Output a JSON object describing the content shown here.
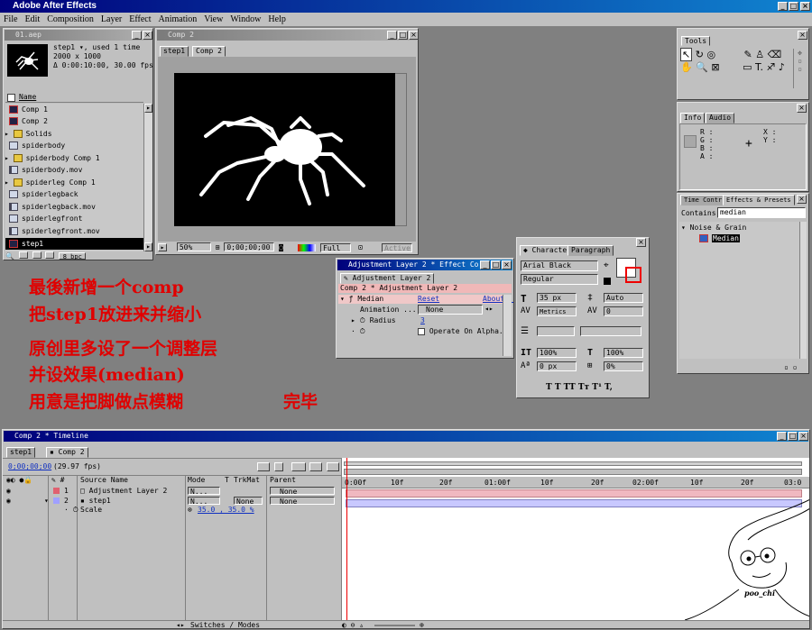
{
  "app": {
    "title": "Adobe After Effects"
  },
  "menu": [
    "File",
    "Edit",
    "Composition",
    "Layer",
    "Effect",
    "Animation",
    "View",
    "Window",
    "Help"
  ],
  "project": {
    "title": "01.aep",
    "info": [
      "step1 ▾, used 1 time",
      "2000 x 1000",
      "Δ 0:00:10:00, 30.00 fps"
    ],
    "header": "Name",
    "items": [
      {
        "name": "Comp 1",
        "type": "comp"
      },
      {
        "name": "Comp 2",
        "type": "comp"
      },
      {
        "name": "Solids",
        "type": "folder"
      },
      {
        "name": "spiderbody",
        "type": "still"
      },
      {
        "name": "spiderbody Comp 1",
        "type": "folder"
      },
      {
        "name": "spiderbody.mov",
        "type": "movie"
      },
      {
        "name": "spiderleg Comp 1",
        "type": "folder"
      },
      {
        "name": "spiderlegback",
        "type": "still"
      },
      {
        "name": "spiderlegback.mov",
        "type": "movie"
      },
      {
        "name": "spiderlegfront",
        "type": "still"
      },
      {
        "name": "spiderlegfront.mov",
        "type": "movie"
      },
      {
        "name": "step1",
        "type": "comp",
        "selected": true
      }
    ],
    "bpc": "8 bpc"
  },
  "comp": {
    "title": "Comp 2",
    "tabs": [
      "step1",
      "Comp 2"
    ],
    "zoom": "50%",
    "time": "0;00;00;00",
    "resolution": "Full",
    "view": "Active"
  },
  "tools": {
    "title": "Tools"
  },
  "info": {
    "tabs": [
      "Info",
      "Audio"
    ],
    "r": "R :",
    "g": "G :",
    "b": "B :",
    "a": "A :",
    "x": "X :",
    "y": "Y :"
  },
  "effects_presets": {
    "tabs": [
      "Time Contr",
      "Effects & Presets"
    ],
    "contains_label": "Contains:",
    "search": "median",
    "category": "Noise & Grain",
    "effect": "Median"
  },
  "effect_controls": {
    "title": "Adjustment Layer 2 * Effect Co",
    "tab": "Adjustment Layer 2",
    "breadcrumb": "Comp 2 * Adjustment Layer 2",
    "effect": "Median",
    "reset": "Reset",
    "about": "About...",
    "anim_label": "Animation ...",
    "anim_value": "None",
    "radius_label": "Radius",
    "radius_value": "3",
    "operate": "Operate On Alpha..."
  },
  "character": {
    "tabs": [
      "Character",
      "Paragraph"
    ],
    "font": "Arial Black",
    "style": "Regular",
    "size": "35 px",
    "leading": "Auto",
    "kerning": "Metrics",
    "tracking": "0",
    "vscale": "100%",
    "hscale": "100%",
    "baseline": "0 px",
    "tsume": "0%",
    "styles": "T  T  TT  Tт  T¹  T,"
  },
  "notes": [
    "最後新增一个comp",
    "把step1放进来并缩小",
    "原创里多设了一个调整层",
    "并设效果(median)",
    "用意是把脚做点模糊",
    "完毕"
  ],
  "timeline": {
    "title": "Comp 2 * Timeline",
    "tabs": [
      "step1",
      "Comp 2"
    ],
    "time": "0;00;00;00",
    "fps": "(29.97 fps)",
    "col_source": "Source Name",
    "col_mode": "Mode",
    "col_t": "T",
    "col_trkmat": "TrkMat",
    "col_parent": "Parent",
    "layers": [
      {
        "num": "1",
        "name": "Adjustment Layer 2",
        "mode": "N...",
        "trkmat": "",
        "parent": "None",
        "color": "#e06070"
      },
      {
        "num": "2",
        "name": "step1",
        "mode": "N...",
        "trkmat": "None",
        "parent": "None",
        "color": "#a0a0ff"
      }
    ],
    "scale_label": "Scale",
    "scale_value": "35.0 , 35.0 %",
    "ruler": [
      "0:00f",
      "10f",
      "20f",
      "01:00f",
      "10f",
      "20f",
      "02:00f",
      "10f",
      "20f",
      "03:0"
    ],
    "switches": "Switches / Modes",
    "signature": "poo_chi"
  }
}
